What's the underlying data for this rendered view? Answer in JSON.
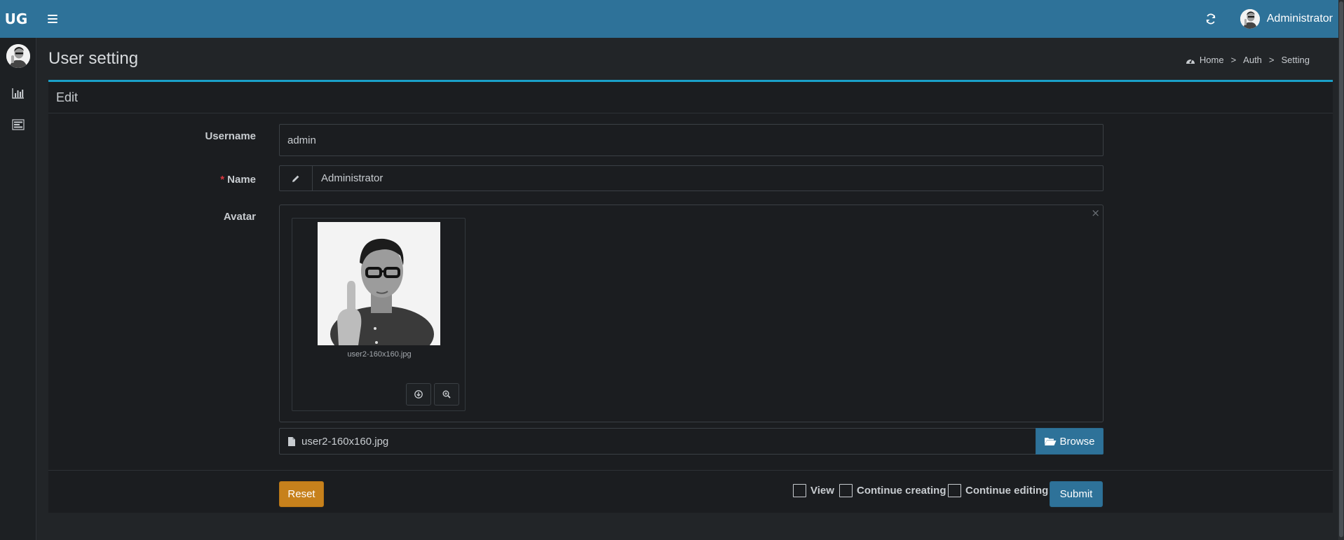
{
  "header": {
    "brand": "UG",
    "user_name": "Administrator"
  },
  "icons": {
    "menu": "hamburger-icon",
    "refresh": "refresh-icon",
    "sidebar": [
      "bar-chart-icon",
      "list-icon"
    ]
  },
  "page": {
    "title": "User setting"
  },
  "breadcrumb": [
    "Home",
    "Auth",
    "Setting"
  ],
  "breadcrumb_sep": ">",
  "box": {
    "title": "Edit"
  },
  "form": {
    "username_label": "Username",
    "username_value": "admin",
    "name_required_mark": "*",
    "name_label": "Name",
    "name_value": "Administrator",
    "avatar_label": "Avatar",
    "avatar_close": "×",
    "avatar_filename": "user2-160x160.jpg",
    "file_caption": "user2-160x160.jpg",
    "browse_label": "Browse"
  },
  "footer": {
    "reset_label": "Reset",
    "view_label": "View",
    "continue_creating_label": "Continue creating",
    "continue_editing_label": "Continue editing",
    "submit_label": "Submit"
  },
  "colors": {
    "header_bg": "#2e7299",
    "accent_border": "#1aa0c8",
    "reset": "#c7811c",
    "submit": "#2e7299",
    "required": "#d9363e"
  }
}
